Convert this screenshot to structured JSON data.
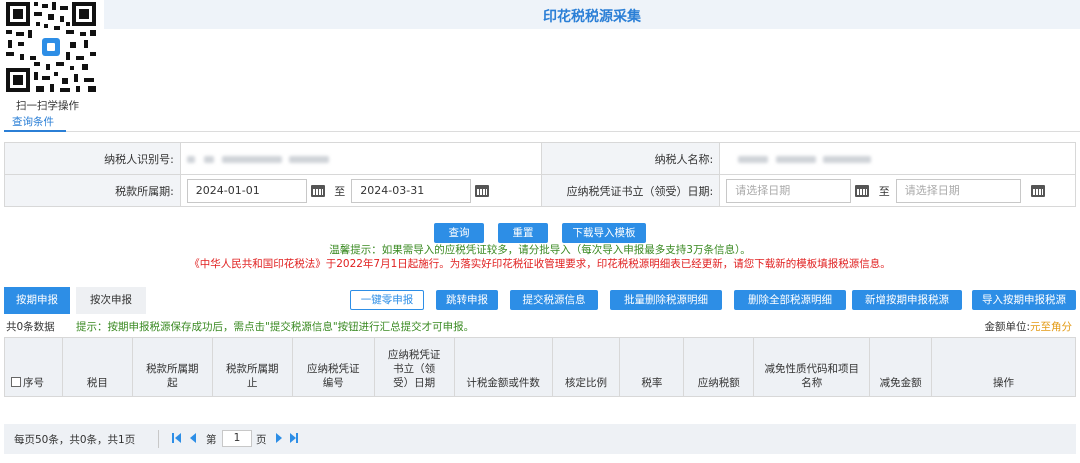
{
  "header": {
    "title": "印花税税源采集",
    "qr_caption": "扫一扫学操作",
    "query_tab": "查询条件"
  },
  "form": {
    "taxpayer_id_label": "纳税人识别号:",
    "taxpayer_name_label": "纳税人名称:",
    "period_label": "税款所属期:",
    "period_start": "2024-01-01",
    "period_end": "2024-03-31",
    "to_label": "至",
    "voucher_date_label": "应纳税凭证书立（领受）日期:",
    "date_placeholder": "请选择日期"
  },
  "actions": {
    "query": "查询",
    "reset": "重置",
    "download_template": "下载导入模板"
  },
  "hints": {
    "green": "温馨提示：如果需导入的应税凭证较多，请分批导入（每次导入申报最多支持3万条信息）。",
    "red": "《中华人民共和国印花税法》于2022年7月1日起施行。为落实好印花税征收管理要求，印花税税源明细表已经更新，请您下载新的模板填报税源信息。"
  },
  "tabs": {
    "periodic": "按期申报",
    "per_time": "按次申报"
  },
  "toolbar": {
    "zero_declare": "一键零申报",
    "redirect_declare": "跳转申报",
    "submit_source": "提交税源信息",
    "batch_delete": "批量删除税源明细",
    "delete_all": "删除全部税源明细",
    "add_periodic": "新增按期申报税源",
    "import_periodic": "导入按期申报税源"
  },
  "list": {
    "count": "共0条数据",
    "tip": "提示：按期申报税源保存成功后，需点击\"提交税源信息\"按钮进行汇总提交才可申报。",
    "unit_label": "金额单位:",
    "unit_value": "元至角分"
  },
  "table": {
    "columns": [
      "序号",
      "税目",
      "税款所属期起",
      "税款所属期止",
      "应纳税凭证编号",
      "应纳税凭证书立（领受）日期",
      "计税金额或件数",
      "核定比例",
      "税率",
      "应纳税额",
      "减免性质代码和项目名称",
      "减免金额",
      "操作"
    ]
  },
  "pager": {
    "info": "每页50条，共0条，共1页",
    "page_prefix": "第",
    "page_value": "1",
    "page_suffix": "页"
  },
  "colors": {
    "accent": "#2d8ee6",
    "title": "#2b7fd6",
    "hint_green": "#3a8a22",
    "hint_red": "#e02020",
    "unit_orange": "#e39b16"
  },
  "icons": [
    "qr-code-icon",
    "calendar-icon",
    "first-page-icon",
    "prev-page-icon",
    "next-page-icon",
    "last-page-icon"
  ]
}
